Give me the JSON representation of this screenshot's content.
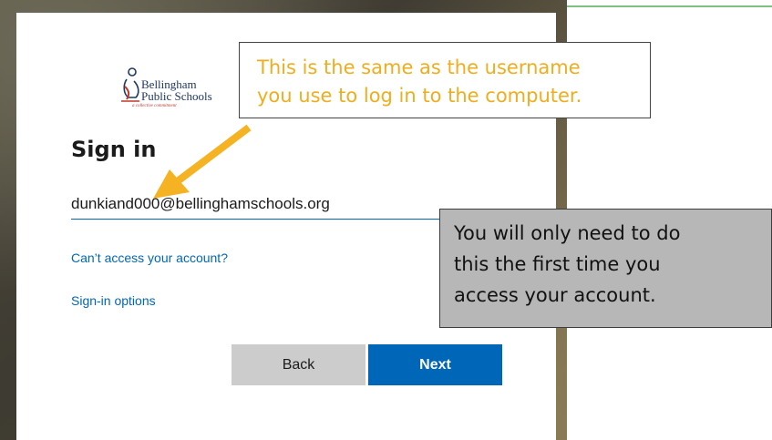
{
  "logo": {
    "line1": "Bellingham",
    "line2": "Public Schools",
    "tagline": "a collective commitment"
  },
  "signin": {
    "title": "Sign in",
    "email_value": "dunkiand000@bellinghamschools.org",
    "cant_access_link": "Can’t access your account?",
    "signin_options_link": "Sign-in options",
    "back_label": "Back",
    "next_label": "Next"
  },
  "callouts": {
    "username_line1": "This is the same as the username",
    "username_line2": "you use to log in to the computer.",
    "first_time_line1": "You will only need to do",
    "first_time_line2": "this the first time you",
    "first_time_line3": "access your account."
  },
  "colors": {
    "accent": "#0067b8",
    "callout_text": "#f0ad1e",
    "arrow": "#f5b324",
    "callout_gray": "#b7b7b7"
  }
}
